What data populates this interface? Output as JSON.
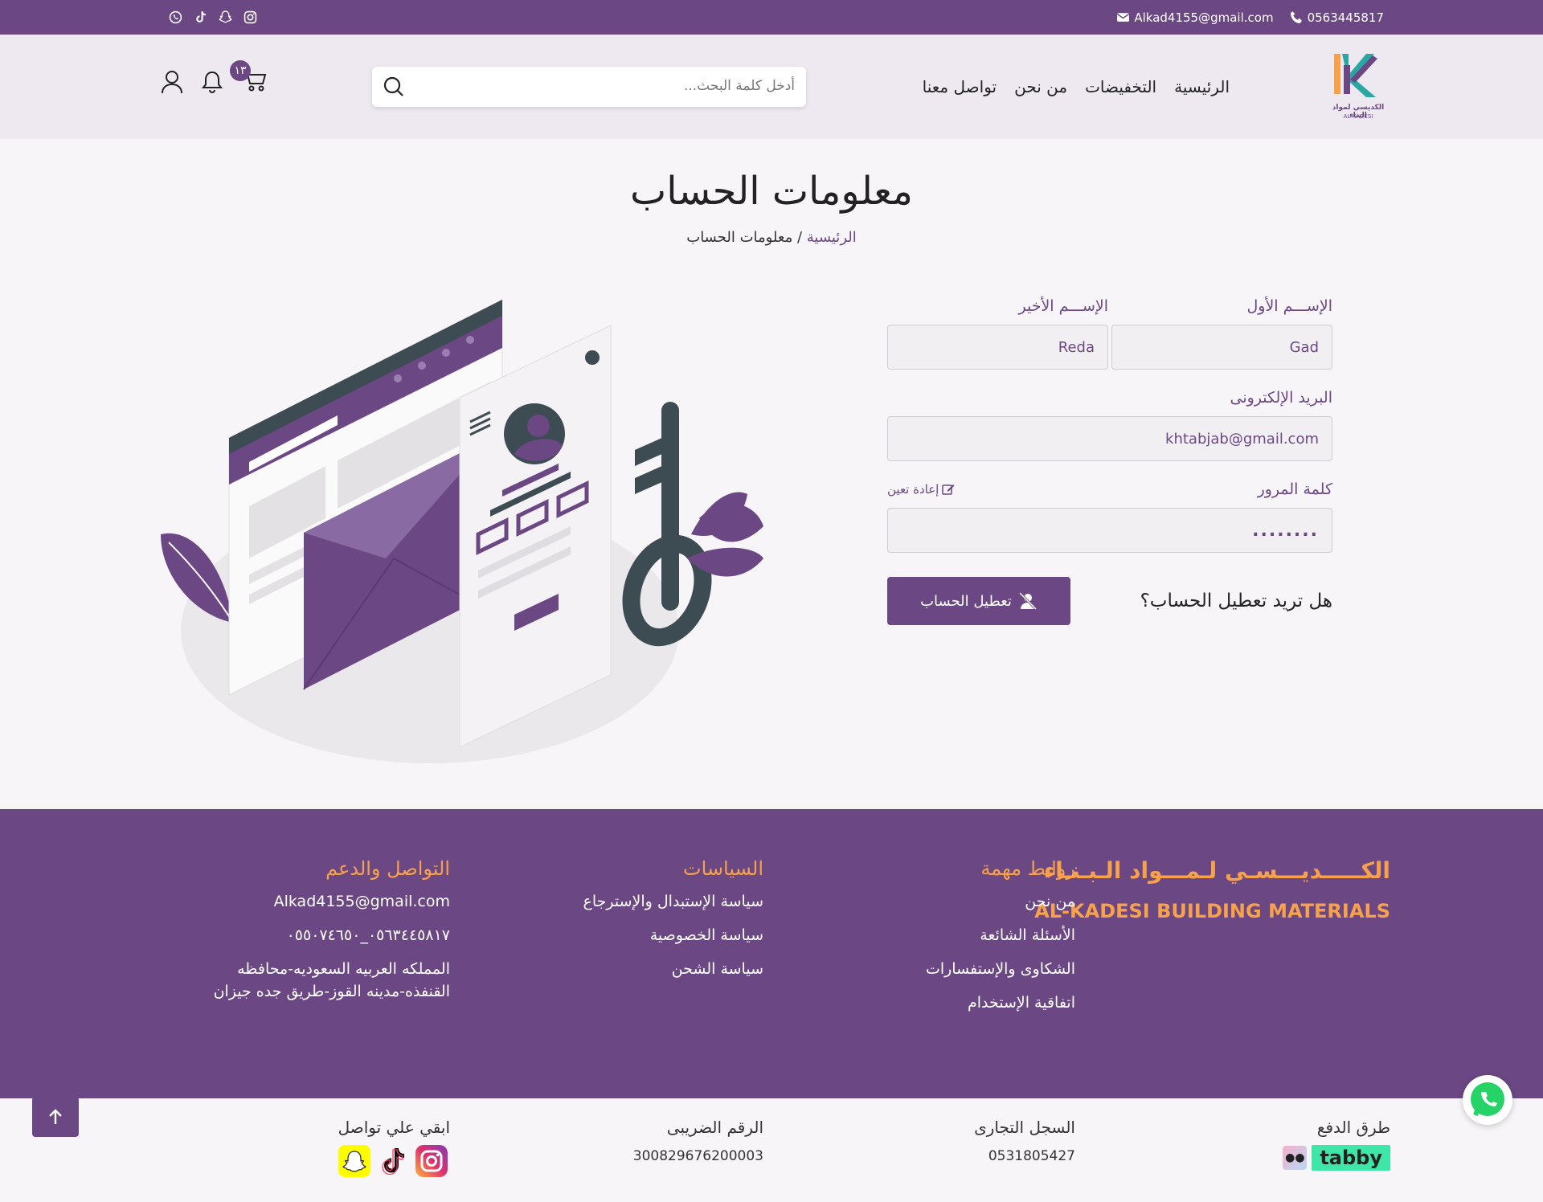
{
  "topbar": {
    "phone": "0563445817",
    "email": "Alkad4155@gmail.com"
  },
  "brand": {
    "logo_text": "الكديسي لمواد البناء",
    "logo_en": "AL-KADESI"
  },
  "nav": {
    "home": "الرئيسية",
    "discounts": "التخفيضات",
    "about": "من نحن",
    "contact": "تواصل معنا"
  },
  "search": {
    "placeholder": "أدخل كلمة البحث..."
  },
  "cart": {
    "count": "١٣"
  },
  "page": {
    "title": "معلومات الحساب",
    "breadcrumb_home": "الرئيسية",
    "breadcrumb_sep": " / ",
    "breadcrumb_current": "معلومات الحساب"
  },
  "form": {
    "first_name_label": "الإســـم الأول",
    "first_name_value": "Gad",
    "last_name_label": "الإســـم الأخير",
    "last_name_value": "Reda",
    "email_label": "البريد الإلكترونى",
    "email_value": "khtabjab@gmail.com",
    "password_label": "كلمة المرور",
    "password_value": "........",
    "reset_label": "إعادة تعين",
    "deactivate_question": "هل تريد تعطيل الحساب؟",
    "deactivate_button": "تعطيل الحساب"
  },
  "footer": {
    "brand_ar": "الكـــــديـــسـي لـمـــواد الـبـنـاء",
    "brand_en": "AL-KADESI BUILDING MATERIALS",
    "links_title": "روابط مهمة",
    "links": [
      "من نحن",
      "الأسئلة الشائعة",
      "الشكاوى والإستفسارات",
      "اتفاقية الإستخدام"
    ],
    "policies_title": "السياسات",
    "policies": [
      "سياسة الإستبدال والإسترجاع",
      "سياسة الخصوصية",
      "سياسة الشحن"
    ],
    "support_title": "التواصل والدعم",
    "support_email": "Alkad4155@gmail.com",
    "support_phones": "٠٥٦٣٤٤٥٨١٧_٠٥٥٠٧٤٦٥٠",
    "support_address_1": "المملكه العربيه السعوديه-محافظه",
    "support_address_2": "القنفذه-مدينه القوز-طريق جده جيزان"
  },
  "bottom": {
    "payment_title": "طرق الدفع",
    "payment_tabby": "tabby",
    "cr_title": "السجل التجارى",
    "cr_value": "0531805427",
    "tax_title": "الرقم الضريبى",
    "tax_value": "300829676200003",
    "follow_title": "ابقي علي تواصل"
  },
  "colors": {
    "primary": "#6b4884",
    "accent": "#f7a24b",
    "header_bg": "#eee9f0"
  }
}
